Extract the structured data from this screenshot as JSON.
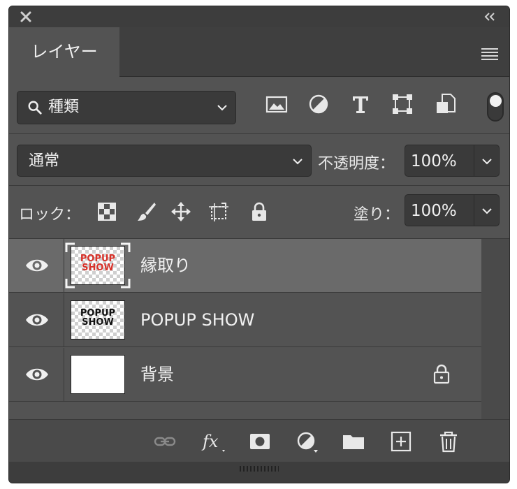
{
  "tab": {
    "label": "レイヤー"
  },
  "filter": {
    "kind_label": "種類"
  },
  "blend": {
    "mode": "通常",
    "opacity_label": "不透明度：",
    "opacity_value": "100%"
  },
  "lock": {
    "label": "ロック：",
    "fill_label": "塗り：",
    "fill_value": "100%"
  },
  "layers": [
    {
      "name": "縁取り",
      "thumb_text": "POPUP\nSHOW",
      "selected": true,
      "locked": false
    },
    {
      "name": "POPUP SHOW",
      "thumb_text": "POPUP\nSHOW",
      "selected": false,
      "locked": false
    },
    {
      "name": "背景",
      "thumb_text": "",
      "selected": false,
      "locked": true
    }
  ],
  "colors": {
    "panel_bg": "#535353",
    "selected_row": "#6a6a6a",
    "thumb_red": "#d8322a"
  },
  "icons": {
    "filters": [
      "image-icon",
      "adjustment-icon",
      "type-icon",
      "shape-icon",
      "smart-object-icon"
    ],
    "locks": [
      "lock-transparent-pixels-icon",
      "lock-image-pixels-icon",
      "lock-position-icon",
      "lock-artboard-icon",
      "lock-all-icon"
    ],
    "footer": [
      "link-icon",
      "fx-icon",
      "mask-icon",
      "adjustment-layer-icon",
      "group-folder-icon",
      "new-layer-icon",
      "trash-icon"
    ]
  }
}
